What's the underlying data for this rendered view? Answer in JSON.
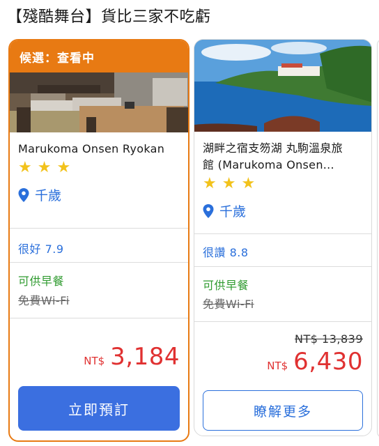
{
  "heading": "【殘酷舞台】貨比三家不吃虧",
  "cards": [
    {
      "banner": "候選：查看中",
      "name": "Marukoma Onsen Ryokan",
      "stars": 3,
      "location": "千歲",
      "rating": "很好 7.9",
      "breakfast": "可供早餐",
      "wifi": "免費Wi-Fi",
      "currency": "NT$",
      "price": "3,184",
      "button": "立即預訂",
      "photo_icon": "hotel-room-photo"
    },
    {
      "name_line1": "湖畔之宿支笏湖 丸駒溫泉旅",
      "name_line2": "館 (Marukoma Onsen...",
      "stars": 3,
      "location": "千歲",
      "rating": "很讚 8.8",
      "breakfast": "可供早餐",
      "wifi": "免費Wi-Fi",
      "old_price": "NT$ 13,839",
      "currency": "NT$",
      "price": "6,430",
      "button": "瞭解更多",
      "photo_icon": "lake-view-photo"
    }
  ],
  "colors": {
    "accent_orange": "#e87a13",
    "link_blue": "#2a6fdb",
    "button_blue": "#3b6fe0",
    "price_red": "#e03131",
    "breakfast_green": "#2e9a2e",
    "star_yellow": "#f2c21b"
  },
  "icons": {
    "star": "star-icon",
    "location": "map-pin-icon"
  }
}
